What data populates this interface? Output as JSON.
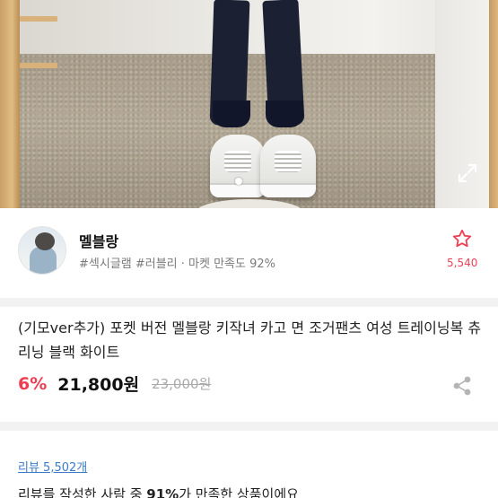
{
  "seller": {
    "name": "멜블랑",
    "tags": "#섹시글램 #러블리 · 마켓 만족도 92%",
    "like_count": "5,540"
  },
  "product": {
    "title": "(기모ver추가) 포켓 버전 멜블랑 키작녀 카고 면 조거팬츠 여성 트레이닝복 츄리닝 블랙 화이트",
    "discount": "6%",
    "price": "21,800원",
    "original_price": "23,000원"
  },
  "review": {
    "link": "리뷰 5,502개",
    "summary_prefix": "리뷰를 작성한 사람 중 ",
    "summary_percent": "91%",
    "summary_suffix": "가 만족한 상품이에요"
  },
  "colors": {
    "accent_pink": "#ef3e52",
    "link_blue": "#3b7bc8"
  },
  "icons": {
    "expand": "expand-icon",
    "star": "star-outline-icon",
    "share": "share-icon"
  },
  "gallery": {
    "current_page": 1
  }
}
